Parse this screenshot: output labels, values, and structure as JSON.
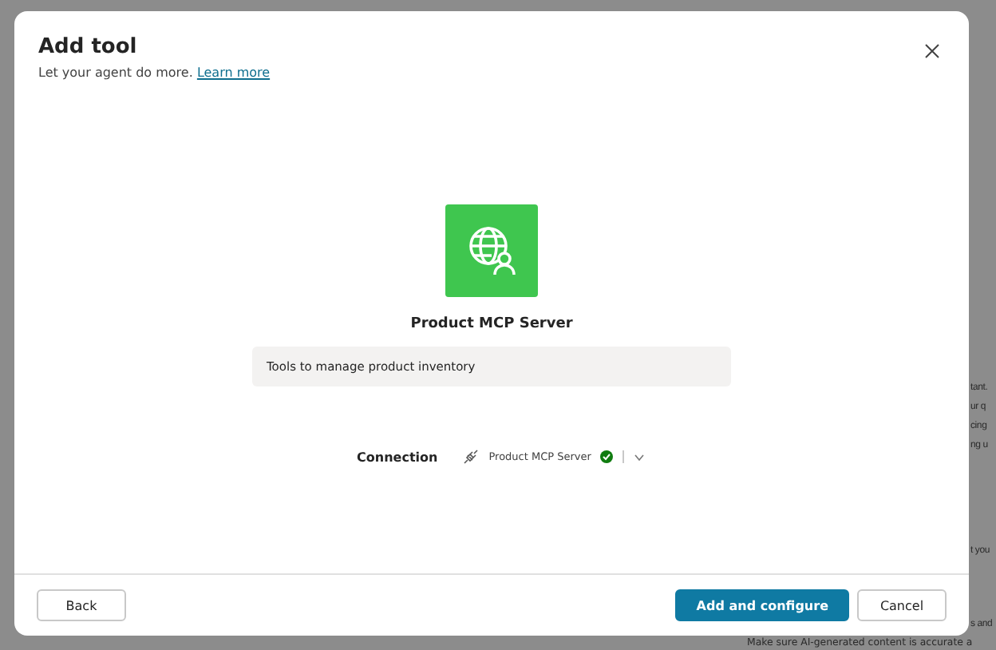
{
  "background_fragments": [
    {
      "text": "tant."
    },
    {
      "text": "ur q"
    },
    {
      "text": "cing"
    },
    {
      "text": "ng u"
    },
    {
      "text": "t you"
    },
    {
      "text": "s and"
    }
  ],
  "background_footer": "Make sure AI-generated content is accurate a",
  "dialog": {
    "title": "Add tool",
    "subtitle": "Let your agent do more.",
    "subtitle_link": "Learn more",
    "tool": {
      "name": "Product MCP Server",
      "description": "Tools to manage product inventory"
    },
    "connection": {
      "label": "Connection",
      "value": "Product MCP Server",
      "connected": true
    },
    "buttons": [
      {
        "label": "Back",
        "kind": "secondary"
      },
      {
        "label": "Add and configure",
        "kind": "primary"
      },
      {
        "label": "Cancel",
        "kind": "secondary"
      }
    ]
  }
}
